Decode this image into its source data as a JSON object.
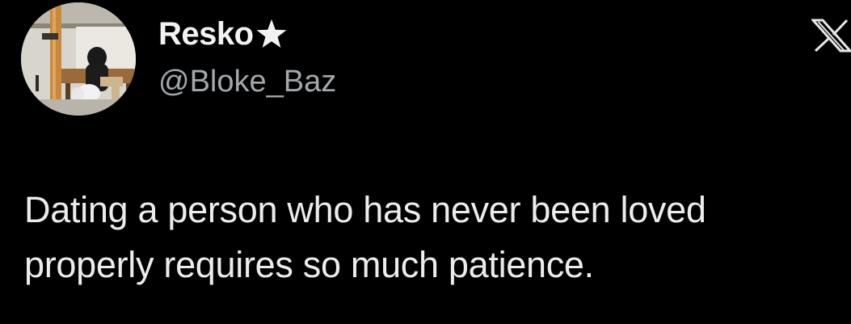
{
  "user": {
    "display_name": "Resko",
    "badge_icon": "star-icon",
    "handle": "@Bloke_Baz",
    "avatar_icon": "profile-photo"
  },
  "platform": {
    "logo_icon": "x-logo-icon"
  },
  "tweet": {
    "text_lines": [
      "Dating a person who has never been loved",
      "properly requires so much patience."
    ]
  },
  "colors": {
    "background": "#000000",
    "name": "#f2f2f2",
    "handle": "#a3a8ad",
    "text": "#ececec"
  }
}
